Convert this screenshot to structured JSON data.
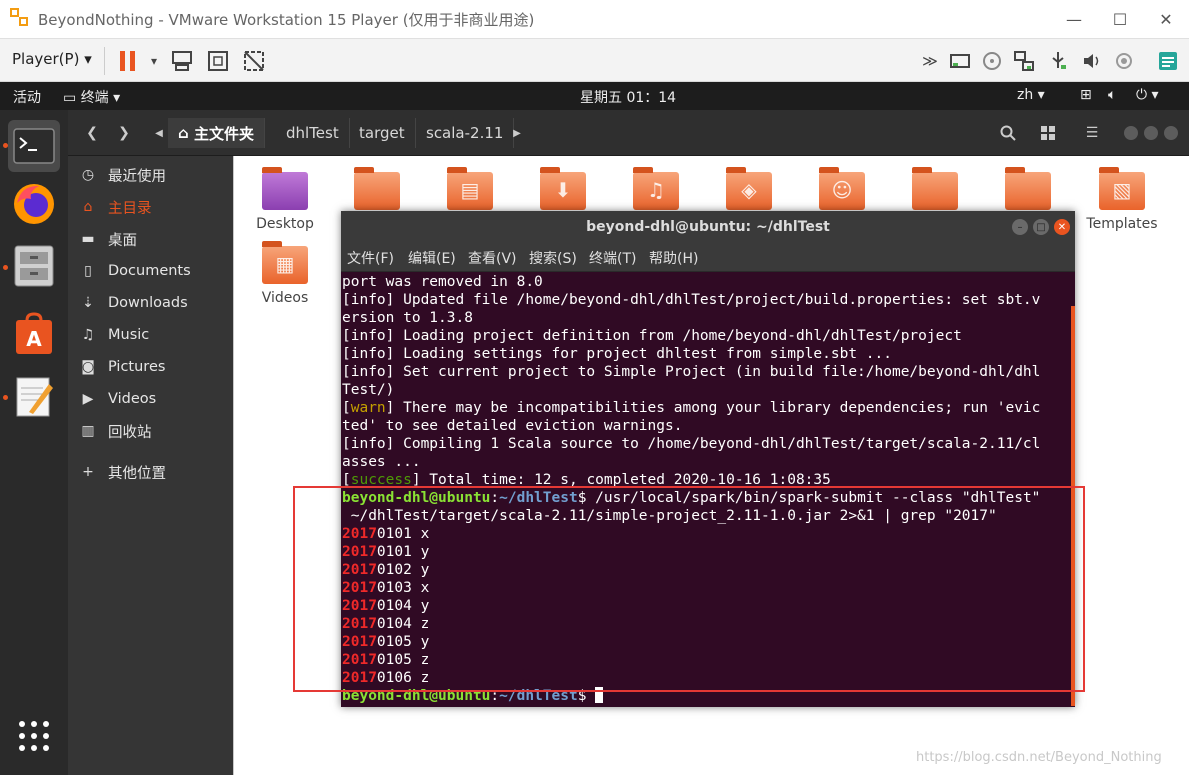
{
  "vm_window": {
    "title": "BeyondNothing - VMware Workstation 15 Player (仅用于非商业用途)",
    "minimize": "—",
    "maximize": "☐",
    "close": "✕"
  },
  "vm_toolbar": {
    "player_menu": "Player(P)",
    "icons": [
      "pause-icon",
      "send-ctrl-alt-del-icon",
      "fullscreen-icon",
      "unity-icon",
      "more-icon",
      "hdd-icon",
      "cd-icon",
      "network-icon",
      "usb-icon",
      "sound-icon",
      "settings-icon",
      "notes-icon"
    ]
  },
  "gnome_bar": {
    "activities": "活动",
    "app_menu": "终端",
    "clock": "星期五 01：14",
    "input_method": "zh"
  },
  "dock": {
    "items": [
      "terminal-icon",
      "firefox-icon",
      "files-icon",
      "software-icon",
      "text-editor-icon",
      "app-grid-icon"
    ]
  },
  "files": {
    "breadcrumbs": [
      "主文件夹",
      "dhlTest",
      "target",
      "scala-2.11"
    ],
    "sidebar": [
      {
        "label": "最近使用",
        "icon": "clock-icon"
      },
      {
        "label": "主目录",
        "icon": "home-icon"
      },
      {
        "label": "桌面",
        "icon": "folder-icon"
      },
      {
        "label": "Documents",
        "icon": "document-icon"
      },
      {
        "label": "Downloads",
        "icon": "download-icon"
      },
      {
        "label": "Music",
        "icon": "music-icon"
      },
      {
        "label": "Pictures",
        "icon": "camera-icon"
      },
      {
        "label": "Videos",
        "icon": "video-icon"
      },
      {
        "label": "回收站",
        "icon": "trash-icon"
      },
      {
        "label": "其他位置",
        "icon": "plus-icon"
      }
    ],
    "items": [
      "Desktop",
      "Templates",
      "Videos"
    ]
  },
  "terminal": {
    "title": "beyond-dhl@ubuntu: ~/dhlTest",
    "menu": [
      "文件(F)",
      "编辑(E)",
      "查看(V)",
      "搜索(S)",
      "终端(T)",
      "帮助(H)"
    ],
    "lines": {
      "l1": "port was removed in 8.0",
      "l2": "[info] Updated file /home/beyond-dhl/dhlTest/project/build.properties: set sbt.v",
      "l3": "ersion to 1.3.8",
      "l4": "[info] Loading project definition from /home/beyond-dhl/dhlTest/project",
      "l5": "[info] Loading settings for project dhltest from simple.sbt ...",
      "l6": "[info] Set current project to Simple Project (in build file:/home/beyond-dhl/dhl",
      "l7": "Test/)",
      "l8_tag": "warn",
      "l8_rest": " There may be incompatibilities among your library dependencies; run 'evic",
      "l9": "ted' to see detailed eviction warnings.",
      "l10": "[info] Compiling 1 Scala source to /home/beyond-dhl/dhlTest/target/scala-2.11/cl",
      "l11": "asses ...",
      "l12_tag": "success",
      "l12_rest": " Total time: 12 s, completed 2020-10-16 1:08:35",
      "prompt_user": "beyond-dhl@ubuntu",
      "prompt_path": "~/dhlTest",
      "command1": " /usr/local/spark/bin/spark-submit --class \"dhlTest\"",
      "command2": " ~/dhlTest/target/scala-2.11/simple-project_2.11-1.0.jar 2>&1 | grep \"2017\"",
      "match": "2017",
      "results": [
        {
          "rest": "0101 x"
        },
        {
          "rest": "0101 y"
        },
        {
          "rest": "0102 y"
        },
        {
          "rest": "0103 x"
        },
        {
          "rest": "0104 y"
        },
        {
          "rest": "0104 z"
        },
        {
          "rest": "0105 y"
        },
        {
          "rest": "0105 z"
        },
        {
          "rest": "0106 z"
        }
      ]
    }
  },
  "watermark": "https://blog.csdn.net/Beyond_Nothing",
  "colors": {
    "terminal_bg": "#300a24",
    "ubuntu_orange": "#e95420",
    "highlight_box": "#e53935"
  }
}
